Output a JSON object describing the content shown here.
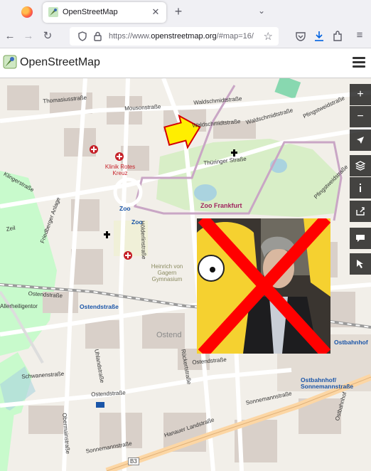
{
  "browser": {
    "tab_title": "OpenStreetMap",
    "url_prefix": "https://www.",
    "url_domain": "openstreetmap.org",
    "url_suffix": "/#map=16/"
  },
  "header": {
    "site_title": "OpenStreetMap"
  },
  "map": {
    "streets": {
      "thomasius": "Thomasiusstraße",
      "mousonstr": "Mousonstraße",
      "waldschmidt1": "Waldschmidtstraße",
      "waldschmidt2": "Waldschmidtstraße",
      "waldschmidt3": "Waldschmidtstraße",
      "pfingst": "Pfingstweidstraße",
      "thuringer": "Thüringer Straße",
      "pfingst2": "Pfingstweidstraße",
      "ostendstr1": "Ostendstraße",
      "ostendstr2": "Ostendstraße",
      "schwanen": "Schwanenstraße",
      "ostendstr3": "Ostendstraße",
      "sonnemann": "Sonnemannstraße",
      "hanauer": "Hanauer Landstraße",
      "sonnemann2": "Sonnemannstraße",
      "uhland": "Uhlandstraße",
      "obermain": "Obermainstraße",
      "ostbahnhof_street": "Ostbahnhof",
      "hoelderlin": "Hölderlinstraße",
      "rueckert": "Rückertstraße",
      "friedberger": "Friedberger Anlage",
      "allerheiligentor": "Allerheiligentor",
      "zeil": "Zeil",
      "klinger": "Klingerstraße"
    },
    "pois": {
      "klinik": "Klinik Rotes Kreuz",
      "zoo_station": "Zoo",
      "zoo_station2": "Zoo",
      "zoo_frankfurt": "Zoo Frankfurt",
      "gymnasium": "Heinrich von Gagern Gymnasium",
      "ostend": "Ostend",
      "ostendstr_station": "Ostendstraße",
      "ostbahnhof_station": "Ostbahnhof",
      "ostbahnhof_sonnemann": "Ostbahnhof/ Sonnemannstraße",
      "b3": "B3"
    }
  },
  "controls": {
    "zoom_in": "+",
    "zoom_out": "−"
  },
  "colors": {
    "arrow": "#ffee00",
    "cross": "#ff0000",
    "zoo_label": "#a0235e",
    "transit": "#1a55a8"
  },
  "icons": [
    "firefox-logo-icon",
    "osm-favicon-icon",
    "close-icon",
    "plus-icon",
    "chevron-down-icon",
    "back-icon",
    "forward-icon",
    "reload-icon",
    "shield-icon",
    "lock-icon",
    "star-icon",
    "pocket-icon",
    "download-icon",
    "extensions-icon",
    "menu-icon",
    "zoom-in-icon",
    "zoom-out-icon",
    "locate-icon",
    "layers-icon",
    "info-icon",
    "share-icon",
    "note-icon",
    "query-icon",
    "church-icon",
    "hospital-icon"
  ]
}
